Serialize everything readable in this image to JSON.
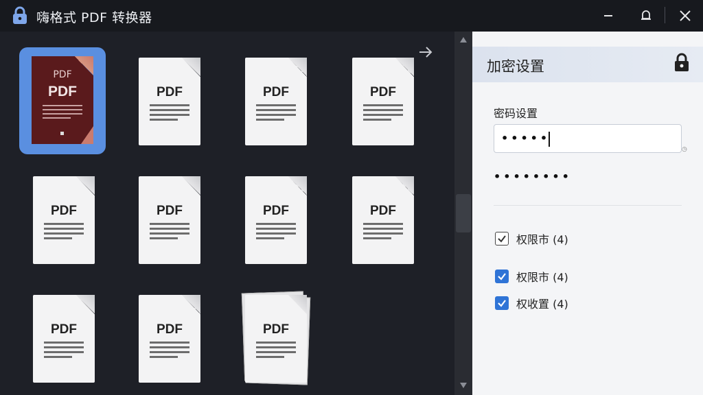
{
  "window": {
    "title": "嗨格式 PDF 转换器"
  },
  "files": {
    "thumb_label": "PDF",
    "selected_label_top": "PDF",
    "items": [
      {
        "name": "file-1"
      },
      {
        "name": "file-2"
      },
      {
        "name": "file-3"
      },
      {
        "name": "file-4"
      },
      {
        "name": "file-5"
      },
      {
        "name": "file-6"
      },
      {
        "name": "file-7"
      },
      {
        "name": "file-8"
      },
      {
        "name": "file-9"
      },
      {
        "name": "file-10"
      },
      {
        "name": "file-11"
      }
    ]
  },
  "panel": {
    "title": "加密设置",
    "password_label": "密码设置",
    "password_value": "•••••",
    "password_confirm": "••••••••",
    "permissions": [
      {
        "label": "权限市 (4)",
        "checked": true,
        "style": "plain"
      },
      {
        "label": "权限市 (4)",
        "checked": true,
        "style": "blue"
      },
      {
        "label": "权收置 (4)",
        "checked": true,
        "style": "blue"
      }
    ]
  },
  "colors": {
    "accent": "#2f74d6",
    "selected_bg": "#5a8fe0",
    "selected_page": "#5a1a1c"
  },
  "icons": [
    "lock-icon",
    "minimize-icon",
    "bell-icon",
    "close-icon",
    "arrow-right-icon",
    "checkmark-icon"
  ]
}
